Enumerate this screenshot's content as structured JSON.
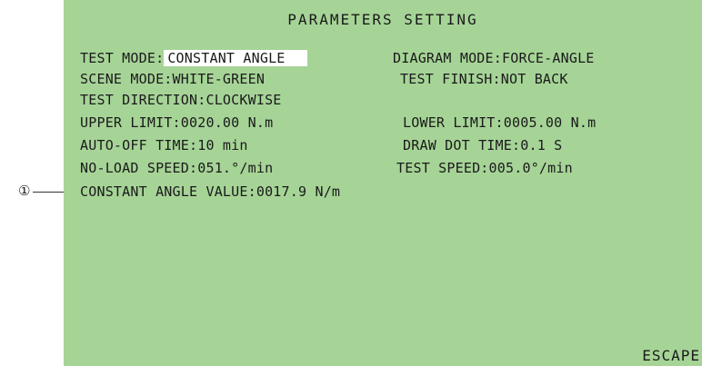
{
  "screen": {
    "title": "PARAMETERS SETTING",
    "escape_label": "ESCAPE",
    "bg_color": "#a6d497"
  },
  "params": {
    "test_mode_label": "TEST MODE:",
    "test_mode_value": "CONSTANT ANGLE",
    "diagram_mode": "DIAGRAM MODE:FORCE-ANGLE",
    "scene_mode": "SCENE MODE:WHITE-GREEN",
    "test_finish": "TEST FINISH:NOT BACK",
    "test_direction": "TEST DIRECTION:CLOCKWISE",
    "upper_limit": "UPPER LIMIT:0020.00 N.m",
    "lower_limit": "LOWER LIMIT:0005.00 N.m",
    "auto_off_time": "AUTO-OFF TIME:10  min",
    "draw_dot_time": "DRAW DOT TIME:0.1 S",
    "no_load_speed": "NO-LOAD SPEED:051.°/min",
    "test_speed": "TEST SPEED:005.0°/min",
    "constant_angle_value": "CONSTANT ANGLE VALUE:0017.9 N/m"
  },
  "annotation": {
    "marker": "①"
  }
}
